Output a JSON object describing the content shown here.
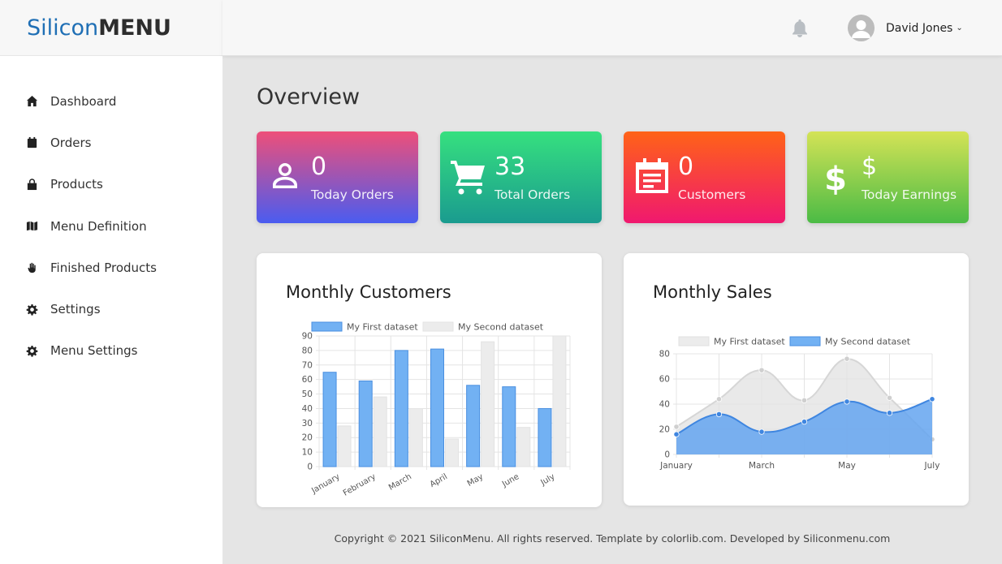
{
  "brand": {
    "part1": "Silicon",
    "part2": "MENU"
  },
  "sidebar": {
    "items": [
      {
        "label": "Dashboard",
        "icon": "home-icon"
      },
      {
        "label": "Orders",
        "icon": "calendar-icon"
      },
      {
        "label": "Products",
        "icon": "shopping-bag-icon"
      },
      {
        "label": "Menu Definition",
        "icon": "map-icon"
      },
      {
        "label": "Finished Products",
        "icon": "hand-icon"
      },
      {
        "label": "Settings",
        "icon": "gear-icon"
      },
      {
        "label": "Menu Settings",
        "icon": "gear-icon"
      }
    ]
  },
  "header": {
    "user_name": "David Jones",
    "chevron": "⌄"
  },
  "page": {
    "title": "Overview"
  },
  "cards": [
    {
      "value": "0",
      "label": "Today Orders",
      "icon": "user-icon"
    },
    {
      "value": "33",
      "label": "Total Orders",
      "icon": "cart-icon"
    },
    {
      "value": "0",
      "label": "Customers",
      "icon": "calendar-list-icon"
    },
    {
      "value": "$",
      "label": "Today Earnings",
      "icon": "dollar-icon"
    }
  ],
  "chart_data": [
    {
      "type": "bar",
      "title": "Monthly Customers",
      "categories": [
        "January",
        "February",
        "March",
        "April",
        "May",
        "June",
        "July"
      ],
      "series": [
        {
          "name": "My First dataset",
          "values": [
            65,
            59,
            80,
            81,
            56,
            55,
            40
          ],
          "color": "#72b1f3"
        },
        {
          "name": "My Second dataset",
          "values": [
            28,
            48,
            40,
            19,
            86,
            27,
            90
          ],
          "color": "#ececec"
        }
      ],
      "ylim": [
        0,
        90
      ],
      "yticks": [
        0,
        10,
        20,
        30,
        40,
        50,
        60,
        70,
        80,
        90
      ],
      "legend": "top",
      "grid": true
    },
    {
      "type": "area",
      "title": "Monthly Sales",
      "categories": [
        "January",
        "",
        "March",
        "",
        "May",
        "",
        "July"
      ],
      "series": [
        {
          "name": "My First dataset",
          "values": [
            22,
            44,
            67,
            43,
            76,
            45,
            12
          ],
          "color": "#e6e6e6"
        },
        {
          "name": "My Second dataset",
          "values": [
            16,
            32,
            18,
            26,
            42,
            33,
            44
          ],
          "color": "#72b1f3"
        }
      ],
      "ylim": [
        0,
        80
      ],
      "yticks": [
        0,
        20,
        40,
        60,
        80
      ],
      "legend": "top",
      "grid": true
    }
  ],
  "footer": {
    "text": "Copyright © 2021 SiliconMenu. All rights reserved. Template by colorlib.com. Developed by Siliconmenu.com"
  }
}
